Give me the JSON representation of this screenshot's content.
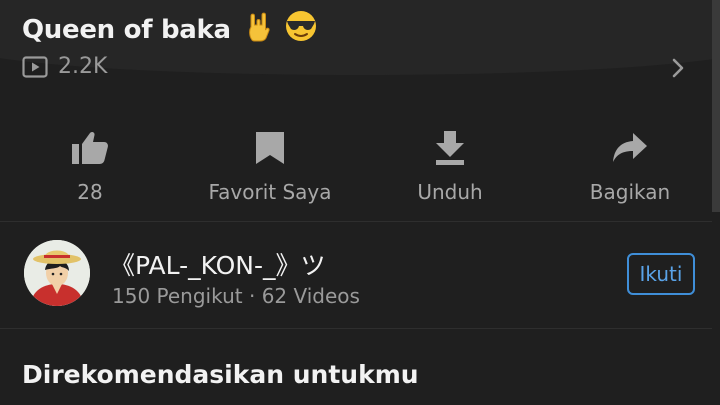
{
  "video": {
    "title": "Queen of baka",
    "title_emojis": [
      "sign-of-the-horns",
      "smiling-face-with-sunglasses"
    ],
    "views": "2.2K",
    "views_icon": "play-box-icon",
    "details_icon": "chevron-right-icon"
  },
  "actions": [
    {
      "icon": "thumbs-up-icon",
      "label": "28"
    },
    {
      "icon": "bookmark-icon",
      "label": "Favorit Saya"
    },
    {
      "icon": "download-icon",
      "label": "Unduh"
    },
    {
      "icon": "share-icon",
      "label": "Bagikan"
    }
  ],
  "channel": {
    "name": "《PAL-_KON-_》ツ",
    "followers": "150 Pengikut",
    "separator": "·",
    "videos": "62 Videos",
    "follow_label": "Ikuti"
  },
  "recommended": {
    "title": "Direkomendasikan untukmu"
  },
  "colors": {
    "background": "#1f1f1f",
    "accent": "#3f8ed8",
    "muted_text": "#9a9a9a"
  }
}
